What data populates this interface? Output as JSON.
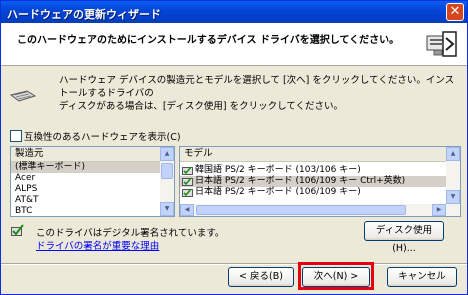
{
  "window": {
    "title": "ハードウェアの更新ウィザード",
    "close": "✕"
  },
  "header": {
    "heading": "このハードウェアのためにインストールするデバイス ドライバを選択してください。"
  },
  "description": {
    "line1": "ハードウェア デバイスの製造元とモデルを選択して [次へ] をクリックしてください。インストールするドライバの",
    "line2": "ディスクがある場合は、[ディスク使用] をクリックしてください。"
  },
  "compat_checkbox": {
    "label": "互換性のあるハードウェアを表示(C)",
    "checked": false
  },
  "manufacturer_list": {
    "header": "製造元",
    "items": [
      "(標準キーボード)",
      "Acer",
      "ALPS",
      "AT&T",
      "BTC"
    ],
    "selected": 0
  },
  "model_list": {
    "header": "モデル",
    "items": [
      "韓国語 PS/2 キーボード (103/106 キー)",
      "日本語 PS/2 キーボード (106/109 キー Ctrl+英数)",
      "日本語 PS/2 キーボード (106/109 キー)"
    ],
    "selected": 1
  },
  "signature": {
    "text": "このドライバはデジタル署名されています。",
    "link": "ドライバの署名が重要な理由"
  },
  "buttons": {
    "disk": "ディスク使用(H)...",
    "back": "< 戻る(B)",
    "next": "次へ(N) >",
    "cancel": "キャンセル"
  },
  "colors": {
    "titlebar": "#0446d8",
    "highlight": "#e60012",
    "selection": "#d4d0c8"
  }
}
